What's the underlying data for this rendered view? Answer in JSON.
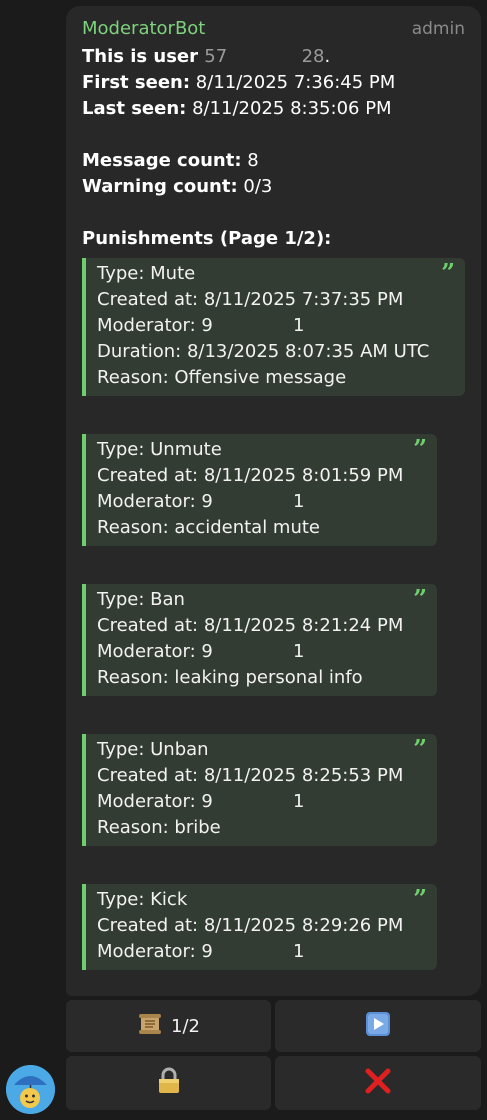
{
  "message": {
    "sender": "ModeratorBot",
    "role": "admin",
    "user_line_prefix": "This is user ",
    "user_id_start": "57",
    "user_id_end": "28",
    "user_line_suffix": ".",
    "first_seen_label": "First seen:",
    "first_seen_value": " 8/11/2025 7:36:45 PM",
    "last_seen_label": "Last seen:",
    "last_seen_value": " 8/11/2025 8:35:06 PM",
    "message_count_label": "Message count:",
    "message_count_value": " 8",
    "warning_count_label": "Warning count:",
    "warning_count_value": " 0/3",
    "punishments_heading": "Punishments (Page 1/2):",
    "punishments": [
      {
        "lines": [
          "Type: Mute",
          "Created at: 8/11/2025 7:37:35 PM",
          "Moderator: 9              1",
          "Duration: 8/13/2025 8:07:35 AM UTC",
          "Reason: Offensive message"
        ]
      },
      {
        "lines": [
          "Type: Unmute",
          "Created at: 8/11/2025 8:01:59 PM",
          "Moderator: 9              1",
          "Reason: accidental mute"
        ]
      },
      {
        "lines": [
          "Type: Ban",
          "Created at: 8/11/2025 8:21:24 PM",
          "Moderator: 9              1",
          "Reason: leaking personal info"
        ]
      },
      {
        "lines": [
          "Type: Unban",
          "Created at: 8/11/2025 8:25:53 PM",
          "Moderator: 9              1",
          "Reason: bribe"
        ]
      },
      {
        "lines": [
          "Type: Kick",
          "Created at: 8/11/2025 8:29:26 PM",
          "Moderator: 9              1"
        ]
      }
    ]
  },
  "buttons": {
    "page_indicator": "1/2",
    "page_icon": "scroll-icon",
    "next_icon": "play-next-icon",
    "lock_icon": "lock-icon",
    "close_icon": "red-cross-icon"
  },
  "colors": {
    "accent_green": "#7fd27d",
    "quote_border": "#6fcf6f",
    "close_red": "#e02020"
  }
}
